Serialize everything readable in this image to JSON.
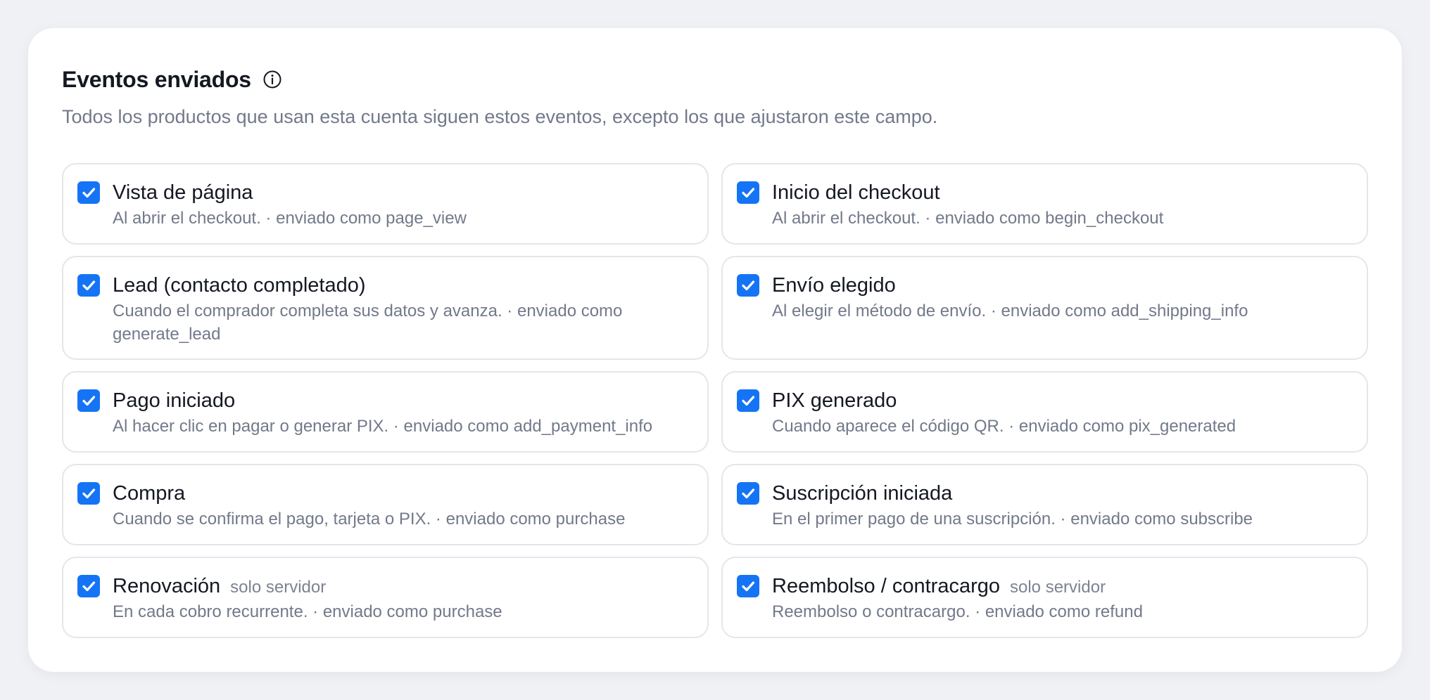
{
  "header": {
    "title": "Eventos enviados",
    "subtitle": "Todos los productos que usan esta cuenta siguen estos eventos, excepto los que ajustaron este campo."
  },
  "colors": {
    "accent": "#1574f5",
    "card_bg": "#ffffff",
    "page_bg": "#eff1f4"
  },
  "events": [
    {
      "name": "Vista de página",
      "tag": "",
      "desc": "Al abrir el checkout. · enviado como page_view",
      "checked": true
    },
    {
      "name": "Inicio del checkout",
      "tag": "",
      "desc": "Al abrir el checkout. · enviado como begin_checkout",
      "checked": true
    },
    {
      "name": "Lead (contacto completado)",
      "tag": "",
      "desc": "Cuando el comprador completa sus datos y avanza. · enviado como generate_lead",
      "checked": true
    },
    {
      "name": "Envío elegido",
      "tag": "",
      "desc": "Al elegir el método de envío. · enviado como add_shipping_info",
      "checked": true
    },
    {
      "name": "Pago iniciado",
      "tag": "",
      "desc": "Al hacer clic en pagar o generar PIX. · enviado como add_payment_info",
      "checked": true
    },
    {
      "name": "PIX generado",
      "tag": "",
      "desc": "Cuando aparece el código QR. · enviado como pix_generated",
      "checked": true
    },
    {
      "name": "Compra",
      "tag": "",
      "desc": "Cuando se confirma el pago, tarjeta o PIX. · enviado como purchase",
      "checked": true
    },
    {
      "name": "Suscripción iniciada",
      "tag": "",
      "desc": "En el primer pago de una suscripción. · enviado como subscribe",
      "checked": true
    },
    {
      "name": "Renovación",
      "tag": "solo servidor",
      "desc": "En cada cobro recurrente. · enviado como purchase",
      "checked": true
    },
    {
      "name": "Reembolso / contracargo",
      "tag": "solo servidor",
      "desc": "Reembolso o contracargo. · enviado como refund",
      "checked": true
    }
  ]
}
